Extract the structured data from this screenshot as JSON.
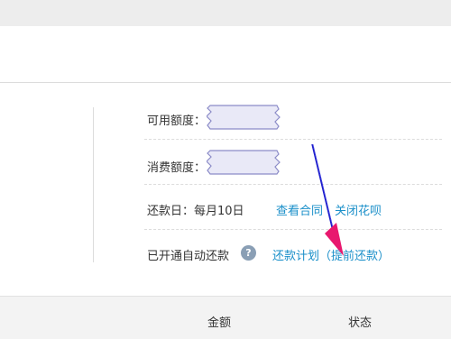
{
  "account": {
    "available_label": "可用额度：",
    "consumed_label": "消费额度：",
    "repay_day_label": "还款日：每月10日",
    "view_contract_link": "查看合同",
    "close_huabei_link": "关闭花呗",
    "autopay_label": "已开通自动还款",
    "help_icon_glyph": "?",
    "repay_plan_link": "还款计划（提前还款）"
  },
  "table_header": {
    "amount_col": "金额",
    "status_col": "状态"
  },
  "colors": {
    "link": "#1a8fc9",
    "annotation_arrow": "#e8186e",
    "annotation_line": "#1a1acb",
    "redaction_fill": "#e9e9f7",
    "redaction_stroke": "#8c8cc8"
  },
  "icons": {
    "help": "question-circle-icon"
  }
}
